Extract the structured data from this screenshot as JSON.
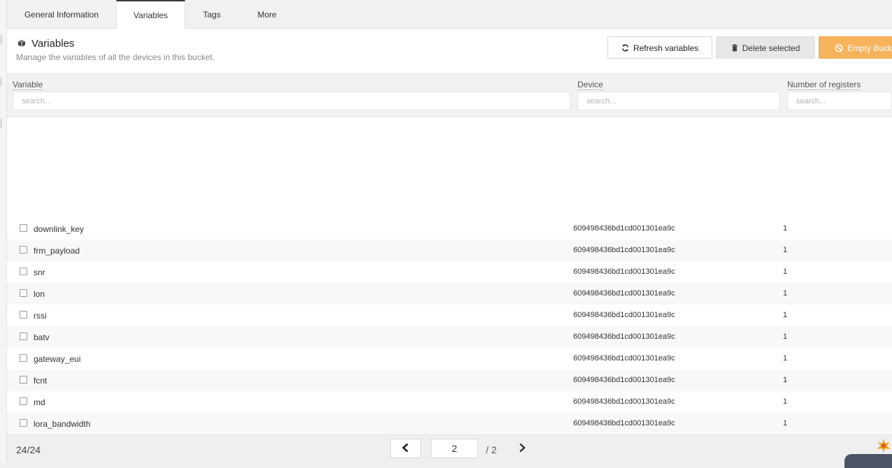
{
  "tabs": [
    {
      "label": "General Information",
      "active": false
    },
    {
      "label": "Variables",
      "active": true
    },
    {
      "label": "Tags",
      "active": false
    },
    {
      "label": "More",
      "active": false
    }
  ],
  "header": {
    "title": "Variables",
    "subtitle": "Manage the variables of all the devices in this bucket.",
    "icon": "cube-icon"
  },
  "toolbar": {
    "refresh_label": "Refresh variables",
    "delete_label": "Delete selected",
    "empty_label": "Empty Bucket",
    "accent_color": "#f7b35c"
  },
  "columns": {
    "variable": {
      "label": "Variable",
      "placeholder": "search..."
    },
    "device": {
      "label": "Device",
      "placeholder": "search..."
    },
    "registers": {
      "label": "Number of registers",
      "placeholder": "search..."
    }
  },
  "rows": [
    {
      "variable": "downlink_key",
      "device": "609498436bd1cd001301ea9c",
      "registers": "1"
    },
    {
      "variable": "frm_payload",
      "device": "609498436bd1cd001301ea9c",
      "registers": "1"
    },
    {
      "variable": "snr",
      "device": "609498436bd1cd001301ea9c",
      "registers": "1"
    },
    {
      "variable": "lon",
      "device": "609498436bd1cd001301ea9c",
      "registers": "1"
    },
    {
      "variable": "rssi",
      "device": "609498436bd1cd001301ea9c",
      "registers": "1"
    },
    {
      "variable": "batv",
      "device": "609498436bd1cd001301ea9c",
      "registers": "1"
    },
    {
      "variable": "gateway_eui",
      "device": "609498436bd1cd001301ea9c",
      "registers": "1"
    },
    {
      "variable": "fcnt",
      "device": "609498436bd1cd001301ea9c",
      "registers": "1"
    },
    {
      "variable": "md",
      "device": "609498436bd1cd001301ea9c",
      "registers": "1"
    },
    {
      "variable": "lora_bandwidth",
      "device": "609498436bd1cd001301ea9c",
      "registers": "1"
    }
  ],
  "footer": {
    "count": "24/24",
    "current_page": "2",
    "total_pages": "/ 2"
  }
}
